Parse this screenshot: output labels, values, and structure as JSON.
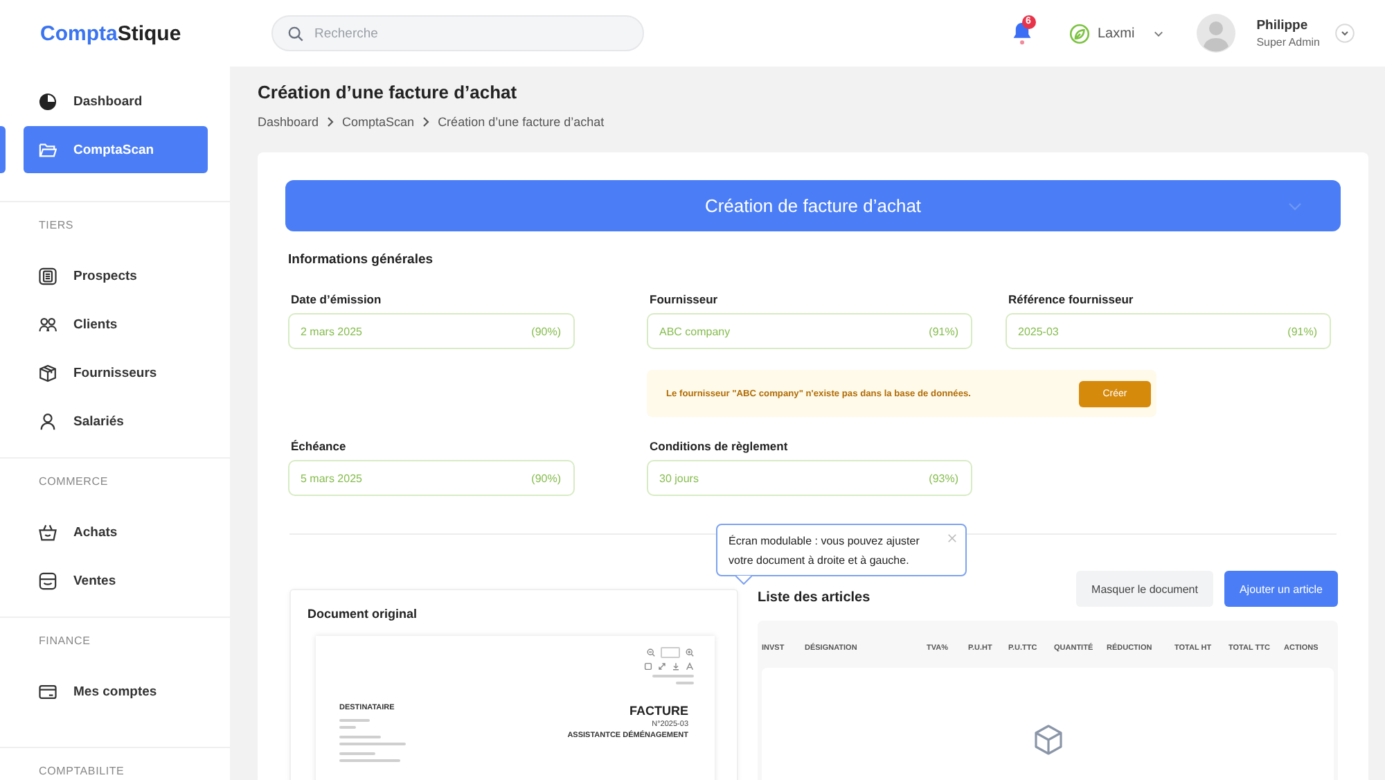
{
  "logo": {
    "accent": "Compta",
    "rest": "Stique"
  },
  "sidebar": {
    "groups": [
      {
        "items": [
          {
            "label": "Dashboard",
            "selected": false
          },
          {
            "label": "ComptaScan",
            "selected": true
          }
        ]
      },
      {
        "title": "TIERS",
        "items": [
          {
            "label": "Prospects",
            "selected": false
          },
          {
            "label": "Clients",
            "selected": false
          },
          {
            "label": "Fournisseurs",
            "selected": false
          },
          {
            "label": "Salariés",
            "selected": false
          }
        ]
      },
      {
        "title": "COMMERCE",
        "items": [
          {
            "label": "Achats",
            "selected": false
          },
          {
            "label": "Ventes",
            "selected": false
          }
        ]
      },
      {
        "title": "FINANCE",
        "items": [
          {
            "label": "Mes comptes",
            "selected": false
          }
        ]
      },
      {
        "title": "COMPTABILITE"
      }
    ]
  },
  "topbar": {
    "search": {
      "placeholder": "Recherche"
    },
    "notifications": {
      "count": "6"
    },
    "company": {
      "name": "Laxmi"
    },
    "user": {
      "name": "Philippe",
      "role": "Super Admin"
    }
  },
  "page": {
    "title": "Création d’une facture d’achat",
    "breadcrumb": [
      "Dashboard",
      "ComptaScan",
      "Création d’une facture d’achat"
    ]
  },
  "form": {
    "banner": "Création de facture d’achat",
    "section": "Informations générales",
    "rows": [
      {
        "kind": "fields",
        "fields": [
          {
            "label": "Date d’émission",
            "value": "2 mars 2025",
            "confidence": "(90%)"
          },
          {
            "label": "Fournisseur",
            "value": "ABC company",
            "confidence": "(91%)"
          },
          {
            "label": "Référence fournisseur",
            "value": "2025-03",
            "confidence": "(91%)"
          }
        ]
      },
      {
        "kind": "notice",
        "message": "Le fournisseur \"ABC company\" n'existe pas dans la base de données.",
        "button": "Créer"
      },
      {
        "kind": "fields",
        "fields": [
          {
            "label": "Échéance",
            "value": "5 mars 2025",
            "confidence": "(90%)"
          },
          {
            "label": "Conditions de règlement",
            "value": "30 jours",
            "confidence": "(93%)"
          }
        ]
      }
    ]
  },
  "tooltip": {
    "text": "Écran modulable : vous pouvez ajuster votre document à droite et à gauche."
  },
  "document": {
    "title": "Document original",
    "preview": {
      "recipient_heading": "DESTINATAIRE",
      "doc_type": "FACTURE",
      "number": "N°2025-03",
      "subject": "ASSISTANTCE DÉMÉNAGEMENT"
    }
  },
  "articles": {
    "title": "Liste des articles",
    "buttons": [
      {
        "label": "Masquer le document",
        "kind": "secondary"
      },
      {
        "label": "Ajouter un article",
        "kind": "primary"
      }
    ],
    "columns": [
      "INVST",
      "DÉSIGNATION",
      "TVA%",
      "P.U.HT",
      "P.U.TTC",
      "QUANTITÉ",
      "RÉDUCTION",
      "TOTAL HT",
      "TOTAL TTC",
      "ACTIONS"
    ]
  }
}
